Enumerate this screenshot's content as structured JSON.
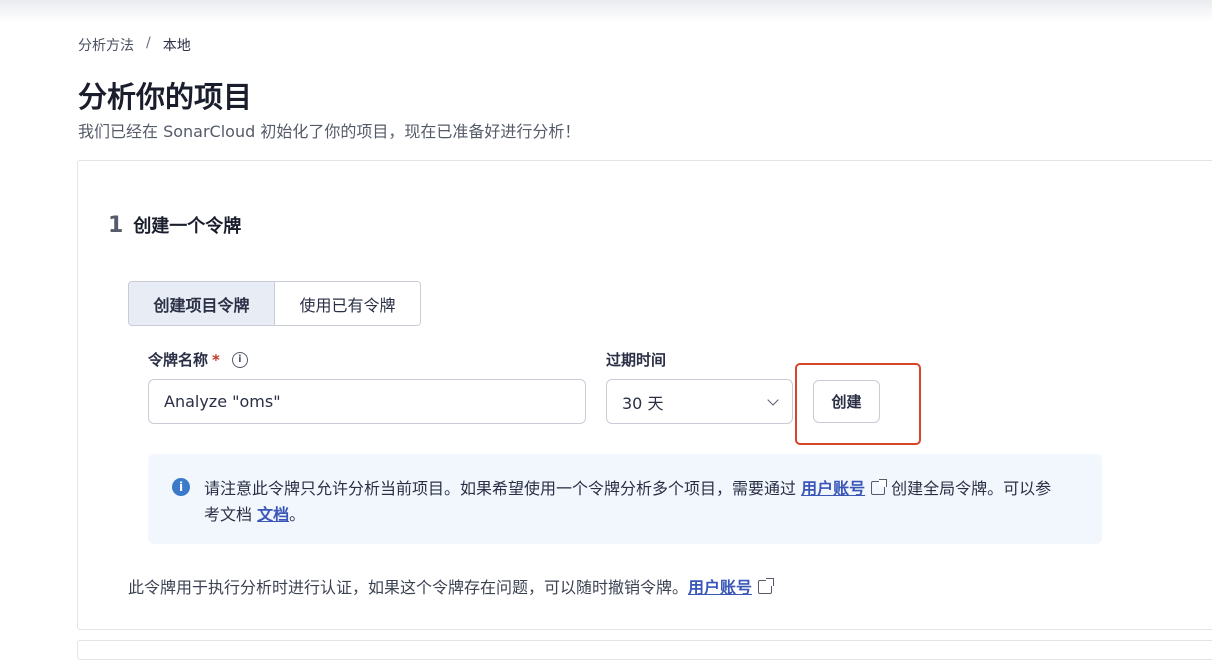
{
  "breadcrumb": {
    "parent": "分析方法",
    "separator": "/",
    "current": "本地"
  },
  "page": {
    "title": "分析你的项目",
    "subtitle": "我们已经在 SonarCloud 初始化了你的项目，现在已准备好进行分析！"
  },
  "step": {
    "number": "1",
    "title": "创建一个令牌"
  },
  "token_type_toggle": {
    "create_label": "创建项目令牌",
    "existing_label": "使用已有令牌"
  },
  "form": {
    "token_name_label": "令牌名称",
    "required_mark": "*",
    "token_name_value": "Analyze \"oms\"",
    "expiry_label": "过期时间",
    "expiry_value": "30 天",
    "create_button": "创建"
  },
  "note": {
    "text_before": "请注意此令牌只允许分析当前项目。如果希望使用一个令牌分析多个项目，需要通过",
    "account_link": "用户账号",
    "text_middle": "创建全局令牌。可以参考文档",
    "docs_link": "文档",
    "text_end": "。"
  },
  "footer": {
    "text": "此令牌用于执行分析时进行认证，如果这个令牌存在问题，可以随时撤销令牌。",
    "account_link": "用户账号"
  },
  "icons": {
    "info": "info-circle-icon",
    "external": "external-link-icon",
    "chevron": "chevron-down-icon"
  },
  "colors": {
    "accent_link": "#3a57b8",
    "highlight_border": "#d6452a",
    "note_bg": "#f2f7fd",
    "required": "#c0392b"
  }
}
